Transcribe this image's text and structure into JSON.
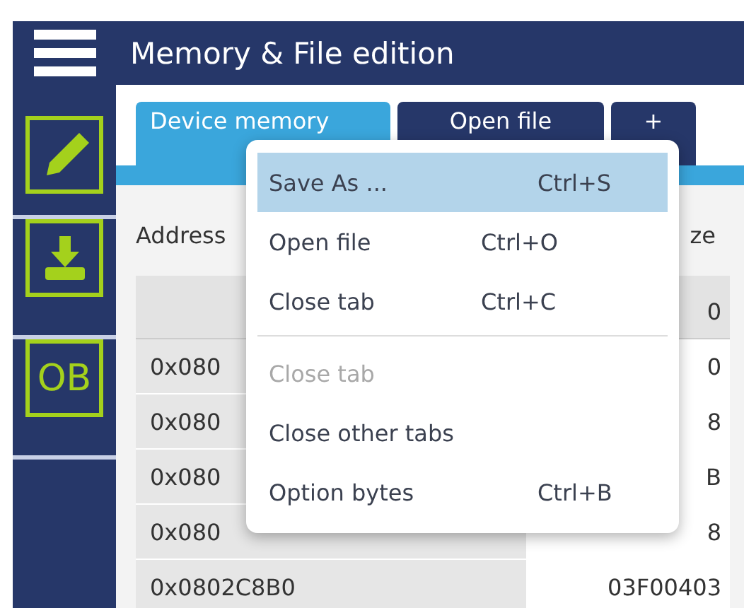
{
  "header": {
    "title": "Memory & File edition"
  },
  "sidebar": {
    "items": [
      {
        "kind": "edit"
      },
      {
        "kind": "download"
      },
      {
        "kind": "text",
        "label": "OB"
      }
    ]
  },
  "tabs": [
    {
      "label": "Device memory",
      "selected": true
    },
    {
      "label": "Open file",
      "selected": false
    },
    {
      "label": "+",
      "selected": false
    }
  ],
  "address_label": "Address",
  "size_label": "ze",
  "table": {
    "columns": [
      "",
      "0"
    ],
    "rows": [
      [
        "0x080",
        "0"
      ],
      [
        "0x080",
        "8"
      ],
      [
        "0x080",
        "B"
      ],
      [
        "0x080",
        "8"
      ],
      [
        "0x0802C8B0",
        "03F00403"
      ]
    ]
  },
  "context_menu": {
    "items": [
      {
        "kind": "item",
        "label": "Save As ...",
        "shortcut": "Ctrl+S",
        "selected": true,
        "disabled": false
      },
      {
        "kind": "item",
        "label": "Open file",
        "shortcut": "Ctrl+O",
        "selected": false,
        "disabled": false
      },
      {
        "kind": "item",
        "label": "Close tab",
        "shortcut": "Ctrl+C",
        "selected": false,
        "disabled": false
      },
      {
        "kind": "separator"
      },
      {
        "kind": "item",
        "label": "Close tab",
        "selected": false,
        "disabled": true
      },
      {
        "kind": "item",
        "label": "Close other tabs",
        "selected": false,
        "disabled": false
      },
      {
        "kind": "item",
        "label": "Option bytes",
        "shortcut": "Ctrl+B",
        "selected": false,
        "disabled": false
      }
    ]
  }
}
